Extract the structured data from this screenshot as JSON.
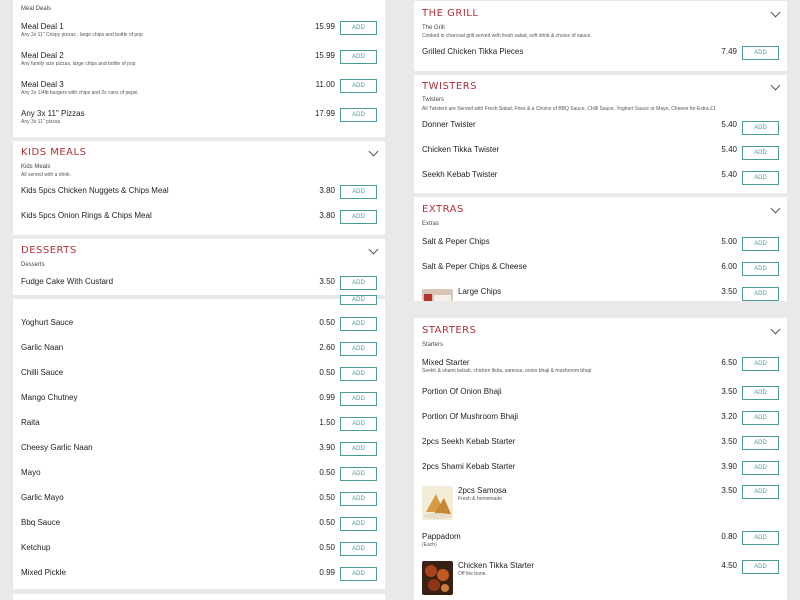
{
  "colors": {
    "accent": "#b0303a",
    "button": "#4a9b95"
  },
  "left": {
    "meal_deals": {
      "subtitle": "Meal Deals",
      "items": [
        {
          "name": "Meal Deal 1",
          "desc": "Any 2x 11\" Crispy pizzas , large chips and bottle of pop",
          "price": "15.99",
          "add": "ADD"
        },
        {
          "name": "Meal Deal 2",
          "desc": "Any family size pizzas, large chips and bottle of pop",
          "price": "15.99",
          "add": "ADD"
        },
        {
          "name": "Meal Deal 3",
          "desc": "Any 2x 1/4lb burgers with chips and 2x cans of pepsi",
          "price": "11.00",
          "add": "ADD"
        },
        {
          "name": "Any 3x 11\" Pizzas",
          "desc": "Any 3x 11\" pizzas",
          "price": "17.99",
          "add": "ADD"
        }
      ]
    },
    "kids_meals": {
      "title": "KIDS MEALS",
      "subtitle": "Kids Meals",
      "desc": "All served with a drink.",
      "items": [
        {
          "name": "Kids 5pcs Chicken Nuggets & Chips Meal",
          "price": "3.80",
          "add": "ADD"
        },
        {
          "name": "Kids 5pcs Onion Rings & Chips Meal",
          "price": "3.80",
          "add": "ADD"
        }
      ]
    },
    "desserts": {
      "title": "Desserts",
      "subtitle": "Desserts",
      "items": [
        {
          "name": "Fudge Cake With Custard",
          "price": "3.50",
          "add": "ADD"
        }
      ],
      "partial_add": "ADD"
    },
    "sauces": {
      "items": [
        {
          "name": "Yoghurt Sauce",
          "price": "0.50",
          "add": "ADD"
        },
        {
          "name": "Garlic Naan",
          "price": "2.60",
          "add": "ADD"
        },
        {
          "name": "Chilli Sauce",
          "price": "0.50",
          "add": "ADD"
        },
        {
          "name": "Mango Chutney",
          "price": "0.99",
          "add": "ADD"
        },
        {
          "name": "Raita",
          "price": "1.50",
          "add": "ADD"
        },
        {
          "name": "Cheesy Garlic Naan",
          "price": "3.90",
          "add": "ADD"
        },
        {
          "name": "Mayo",
          "price": "0.50",
          "add": "ADD"
        },
        {
          "name": "Garlic Mayo",
          "price": "0.50",
          "add": "ADD"
        },
        {
          "name": "Bbq Sauce",
          "price": "0.50",
          "add": "ADD"
        },
        {
          "name": "Ketchup",
          "price": "0.50",
          "add": "ADD"
        },
        {
          "name": "Mixed Pickle",
          "price": "0.99",
          "add": "ADD"
        }
      ]
    }
  },
  "right": {
    "grill": {
      "title": "THE GRILL",
      "subtitle": "The Grill",
      "desc": "Cooked in charcoal grill served with fresh salad, soft drink & choice of sauce.",
      "items": [
        {
          "name": "Grilled Chicken Tikka Pieces",
          "price": "7.49",
          "add": "ADD"
        }
      ]
    },
    "twisters": {
      "title": "Twisters",
      "subtitle": "Twisters",
      "desc": "All Twisters are Served with Fresh Salad, Fries & a Choice of BBQ Sauce, Chilli Sauce, Yoghurt Sauce or Mayo, Cheese for Extra £1",
      "items": [
        {
          "name": "Donner Twister",
          "price": "5.40",
          "add": "ADD"
        },
        {
          "name": "Chicken Tikka Twister",
          "price": "5.40",
          "add": "ADD"
        },
        {
          "name": "Seekh Kebab Twister",
          "price": "5.40",
          "add": "ADD"
        }
      ]
    },
    "extras": {
      "title": "Extras",
      "subtitle": "Extras",
      "items": [
        {
          "name": "Salt & Peper Chips",
          "price": "5.00",
          "add": "ADD"
        },
        {
          "name": "Salt & Peper Chips & Cheese",
          "price": "6.00",
          "add": "ADD"
        },
        {
          "name": "Large Chips",
          "price": "3.50",
          "add": "ADD"
        }
      ]
    },
    "starters": {
      "title": "Starters",
      "subtitle": "Starters",
      "items": [
        {
          "name": "Mixed Starter",
          "desc": "Seekh & shami kebab, chicken tikka, samosa, onion bhaji & mushroom bhaji",
          "price": "6.50",
          "add": "ADD"
        },
        {
          "name": "Portion Of Onion Bhaji",
          "price": "3.50",
          "add": "ADD"
        },
        {
          "name": "Portion Of Mushroom Bhaji",
          "price": "3.20",
          "add": "ADD"
        },
        {
          "name": "2pcs Seekh Kebab Starter",
          "price": "3.50",
          "add": "ADD"
        },
        {
          "name": "2pcs Shami Kebab Starter",
          "price": "3.90",
          "add": "ADD"
        },
        {
          "name": "2pcs Samosa",
          "desc": "Fresh & homemade",
          "price": "3.50",
          "add": "ADD"
        },
        {
          "name": "Pappadom",
          "desc": "(Each)",
          "price": "0.80",
          "add": "ADD"
        },
        {
          "name": "Chicken Tikka Starter",
          "desc": "Off the bone.",
          "price": "4.50",
          "add": "ADD"
        }
      ]
    }
  }
}
